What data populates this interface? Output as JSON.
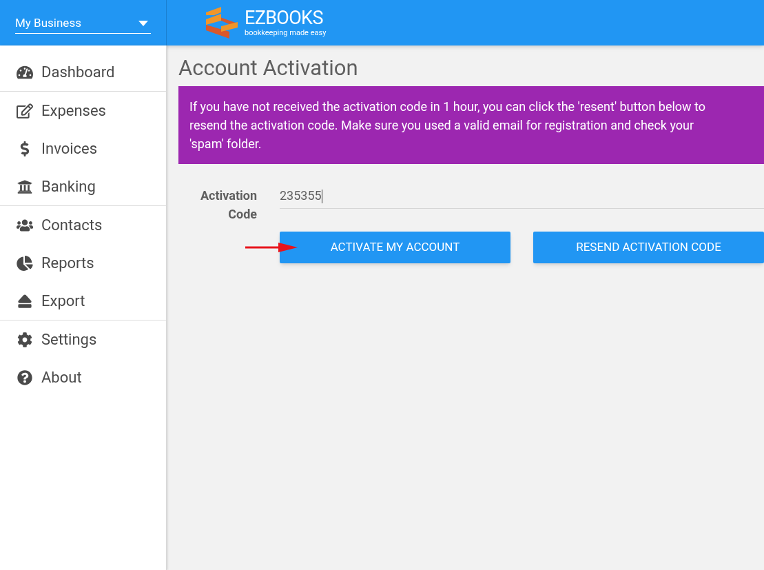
{
  "business_selector": {
    "value": "My Business"
  },
  "logo": {
    "name": "EZBOOKS",
    "tagline": "bookkeeping made easy"
  },
  "sidebar": {
    "groups": [
      {
        "items": [
          {
            "label": "Dashboard"
          }
        ]
      },
      {
        "items": [
          {
            "label": "Expenses"
          },
          {
            "label": "Invoices"
          },
          {
            "label": "Banking"
          }
        ]
      },
      {
        "items": [
          {
            "label": "Contacts"
          },
          {
            "label": "Reports"
          },
          {
            "label": "Export"
          }
        ]
      },
      {
        "items": [
          {
            "label": "Settings"
          },
          {
            "label": "About"
          }
        ]
      }
    ]
  },
  "page": {
    "title": "Account Activation",
    "notice": "If you have not received the activation code in 1 hour, you can click the 'resent' button below to resend the activation code. Make sure you used a valid email for registration and check your 'spam' folder.",
    "field": {
      "label": "Activation Code",
      "value": "235355"
    },
    "buttons": [
      "ACTIVATE MY ACCOUNT",
      "RESEND ACTIVATION CODE"
    ]
  }
}
